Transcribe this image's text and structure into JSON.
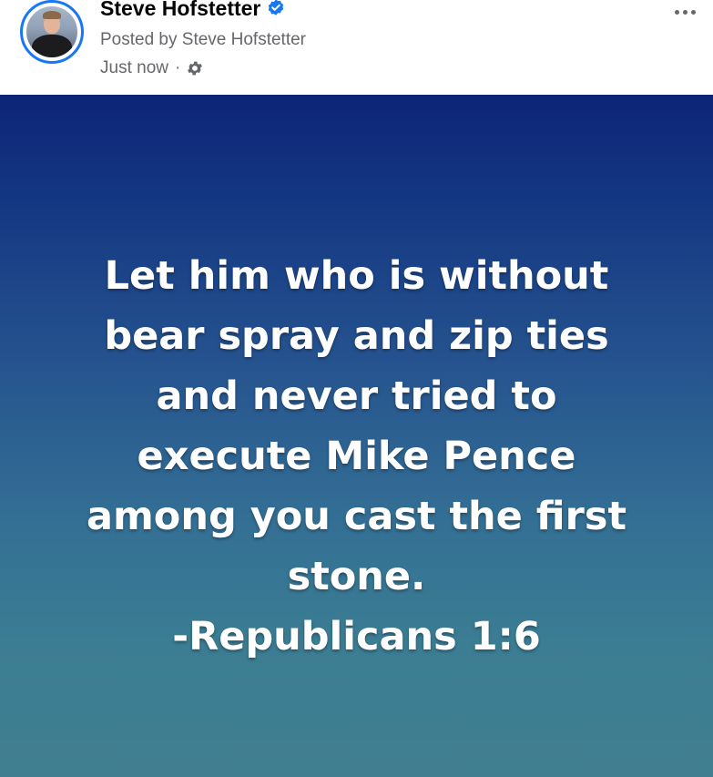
{
  "post": {
    "author_name": "Steve Hofstetter",
    "posted_by": "Posted by Steve Hofstetter",
    "timestamp": "Just now",
    "separator": "·",
    "icons": {
      "verified": "verified-badge-icon",
      "audience": "gear-icon",
      "more": "more-options-icon"
    },
    "colors": {
      "verified_badge": "#1877f2",
      "background_top": "#0c2476",
      "background_bottom": "#417f90",
      "text": "#ffffff"
    },
    "text_lines": [
      "Let him who is without",
      "bear spray and zip ties",
      "and never tried to",
      "execute Mike Pence",
      "among you cast the first",
      "stone.",
      "-Republicans 1:6"
    ]
  }
}
